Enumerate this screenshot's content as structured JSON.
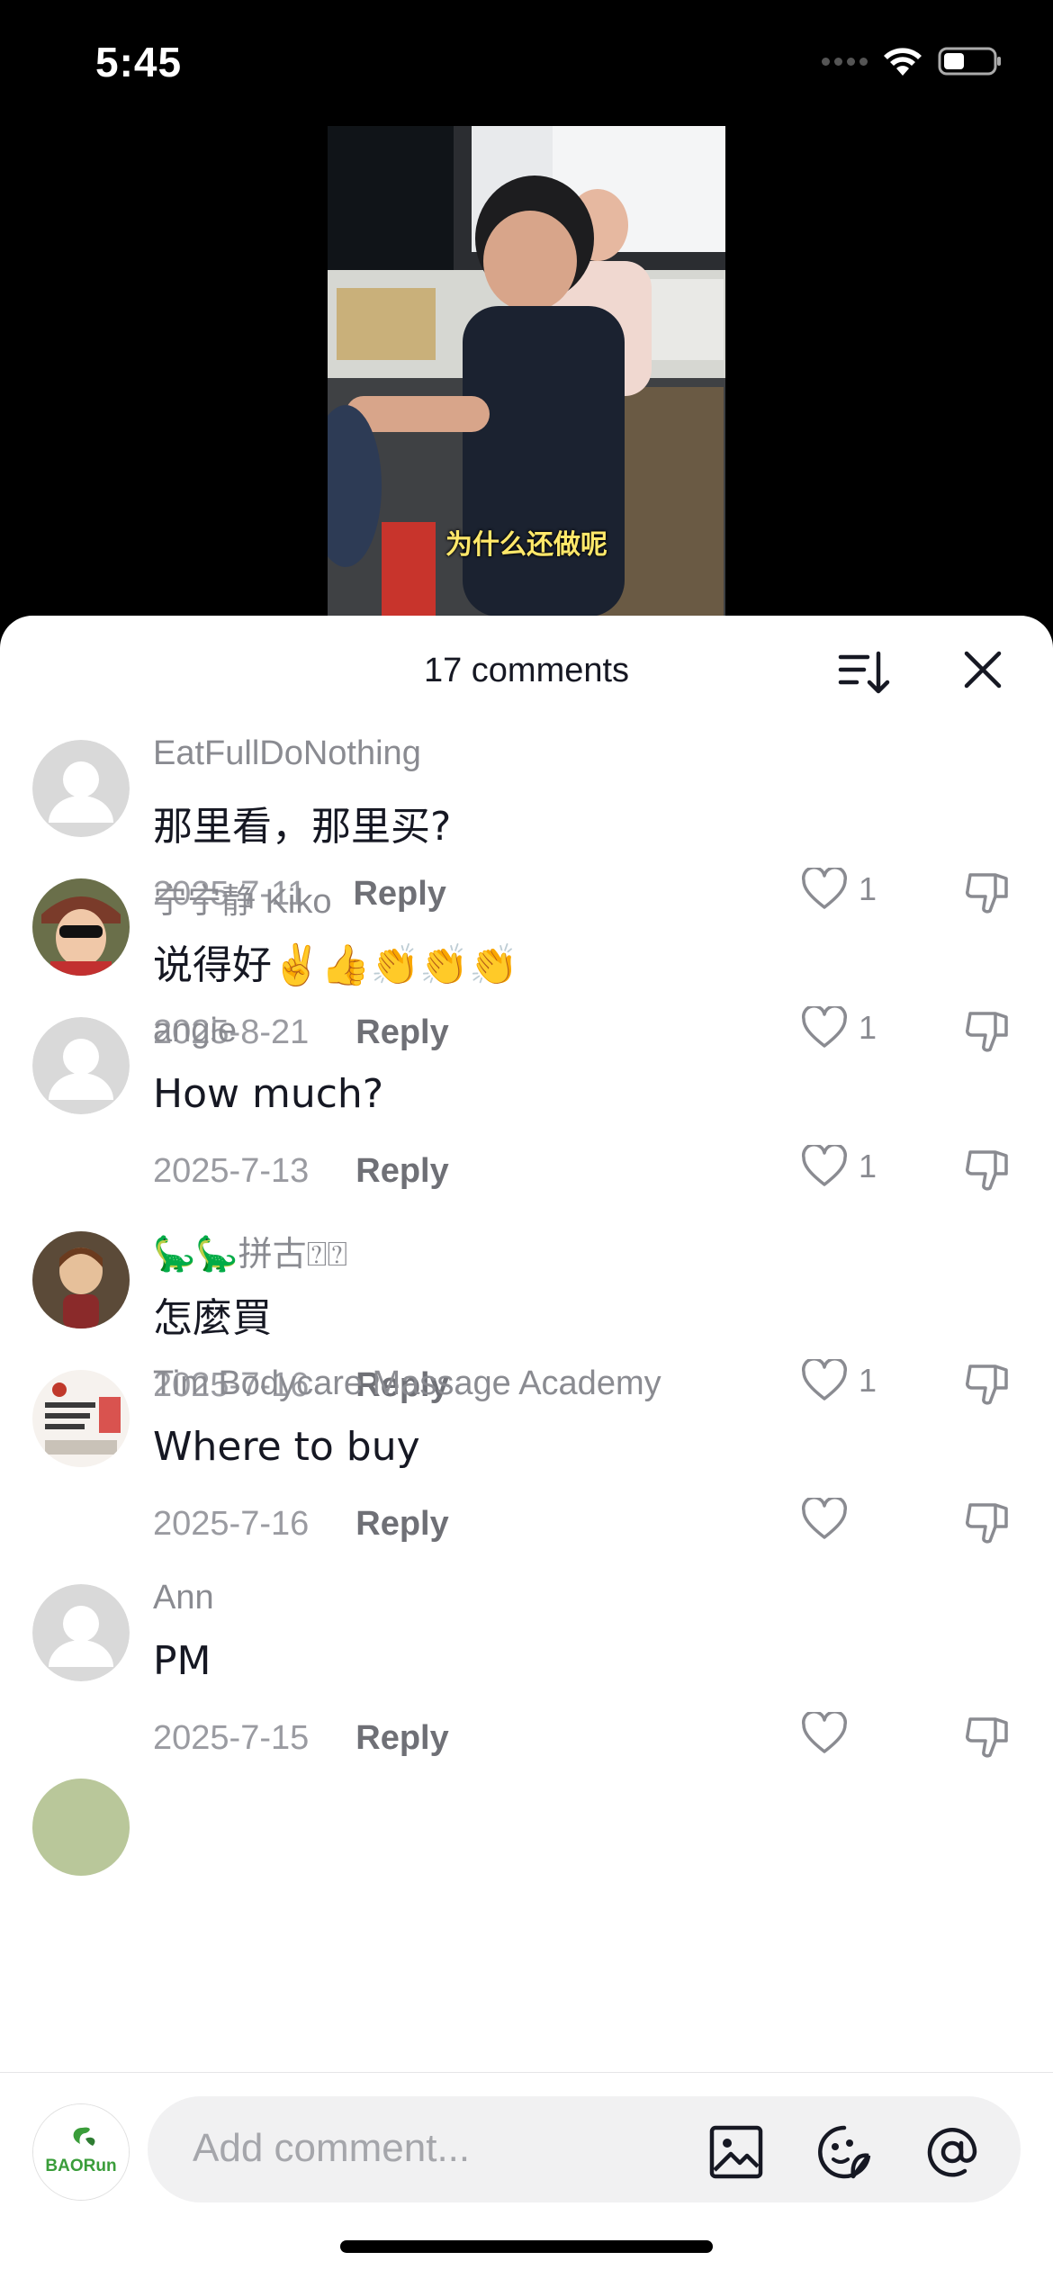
{
  "status_bar": {
    "time": "5:45"
  },
  "video": {
    "caption": "为什么还做呢"
  },
  "comments_sheet": {
    "title": "17 comments",
    "reply_label": "Reply",
    "comments": [
      {
        "username": "EatFullDoNothing",
        "text": "那里看，那里买?",
        "date": "2025-7-11",
        "likes": "1"
      },
      {
        "username": "宁宁静 Kiko",
        "text": "说得好✌️👍👏👏👏",
        "date": "2025-8-21",
        "likes": "1"
      },
      {
        "username": "angie",
        "text": "How much?",
        "date": "2025-7-13",
        "likes": "1"
      },
      {
        "username": "🦕🦕拼古⍰⍰",
        "text": "怎麼買",
        "date": "2025-7-16",
        "likes": "1"
      },
      {
        "username": "Tim Bodycare Massage Academy",
        "text": "Where to buy",
        "date": "2025-7-16",
        "likes": ""
      },
      {
        "username": "Ann",
        "text": "PM",
        "date": "2025-7-15",
        "likes": ""
      }
    ]
  },
  "composer": {
    "placeholder": "Add comment...",
    "avatar_brand": "BAORun"
  },
  "colors": {
    "accent_green": "#3a9d3a",
    "text_primary": "#161823",
    "text_secondary": "#8a8b91"
  }
}
